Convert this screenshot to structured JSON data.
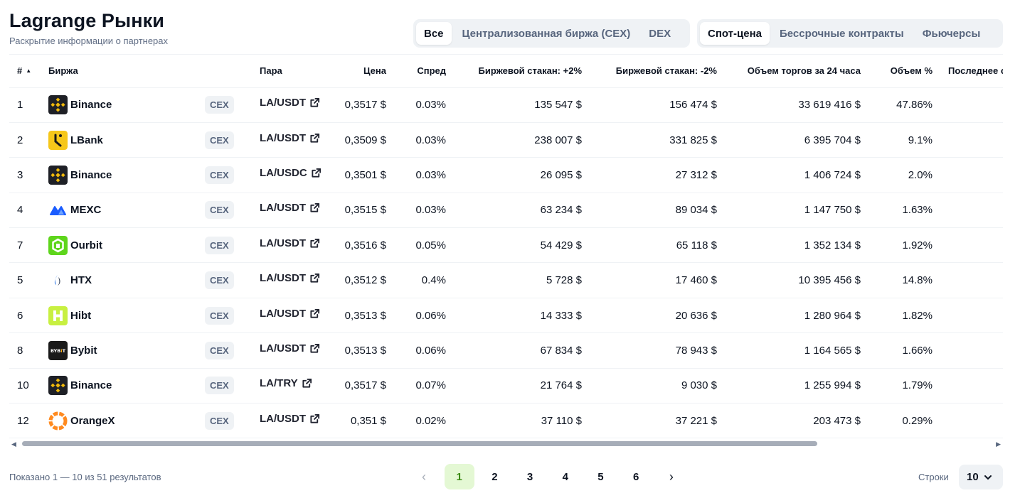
{
  "header": {
    "title": "Lagrange Рынки",
    "subtitle": "Раскрытие информации о партнерах"
  },
  "filters": {
    "market_type": [
      "Все",
      "Централизованная биржа (CEX)",
      "DEX"
    ],
    "market_type_active": "Все",
    "category": [
      "Спот-цена",
      "Бессрочные контракты",
      "Фьючерсы"
    ],
    "category_active": "Спот-цена"
  },
  "table": {
    "columns": [
      "#",
      "Биржа",
      "Пара",
      "Цена",
      "Спред",
      "Биржевой стакан: +2%",
      "Биржевой стакан: -2%",
      "Объем торгов за 24 часа",
      "Объем %",
      "Последнее о"
    ],
    "sort_indicator": "▲",
    "rows": [
      {
        "rank": "1",
        "exchange": "Binance",
        "icon": "binance-icon",
        "type": "CEX",
        "pair": "LA/USDT",
        "price": "0,3517 $",
        "spread": "0.03%",
        "depth_plus": "135 547 $",
        "depth_minus": "156 474 $",
        "volume": "33 619 416 $",
        "volume_pct": "47.86%"
      },
      {
        "rank": "2",
        "exchange": "LBank",
        "icon": "lbank-icon",
        "type": "CEX",
        "pair": "LA/USDT",
        "price": "0,3509 $",
        "spread": "0.03%",
        "depth_plus": "238 007 $",
        "depth_minus": "331 825 $",
        "volume": "6 395 704 $",
        "volume_pct": "9.1%"
      },
      {
        "rank": "3",
        "exchange": "Binance",
        "icon": "binance-icon",
        "type": "CEX",
        "pair": "LA/USDC",
        "price": "0,3501 $",
        "spread": "0.03%",
        "depth_plus": "26 095 $",
        "depth_minus": "27 312 $",
        "volume": "1 406 724 $",
        "volume_pct": "2.0%"
      },
      {
        "rank": "4",
        "exchange": "MEXC",
        "icon": "mexc-icon",
        "type": "CEX",
        "pair": "LA/USDT",
        "price": "0,3515 $",
        "spread": "0.03%",
        "depth_plus": "63 234 $",
        "depth_minus": "89 034 $",
        "volume": "1 147 750 $",
        "volume_pct": "1.63%"
      },
      {
        "rank": "7",
        "exchange": "Ourbit",
        "icon": "ourbit-icon",
        "type": "CEX",
        "pair": "LA/USDT",
        "price": "0,3516 $",
        "spread": "0.05%",
        "depth_plus": "54 429 $",
        "depth_minus": "65 118 $",
        "volume": "1 352 134 $",
        "volume_pct": "1.92%"
      },
      {
        "rank": "5",
        "exchange": "HTX",
        "icon": "htx-icon",
        "type": "CEX",
        "pair": "LA/USDT",
        "price": "0,3512 $",
        "spread": "0.4%",
        "depth_plus": "5 728 $",
        "depth_minus": "17 460 $",
        "volume": "10 395 456 $",
        "volume_pct": "14.8%"
      },
      {
        "rank": "6",
        "exchange": "Hibt",
        "icon": "hibt-icon",
        "type": "CEX",
        "pair": "LA/USDT",
        "price": "0,3513 $",
        "spread": "0.06%",
        "depth_plus": "14 333 $",
        "depth_minus": "20 636 $",
        "volume": "1 280 964 $",
        "volume_pct": "1.82%"
      },
      {
        "rank": "8",
        "exchange": "Bybit",
        "icon": "bybit-icon",
        "type": "CEX",
        "pair": "LA/USDT",
        "price": "0,3513 $",
        "spread": "0.06%",
        "depth_plus": "67 834 $",
        "depth_minus": "78 943 $",
        "volume": "1 164 565 $",
        "volume_pct": "1.66%"
      },
      {
        "rank": "10",
        "exchange": "Binance",
        "icon": "binance-icon",
        "type": "CEX",
        "pair": "LA/TRY",
        "price": "0,3517 $",
        "spread": "0.07%",
        "depth_plus": "21 764 $",
        "depth_minus": "9 030 $",
        "volume": "1 255 994 $",
        "volume_pct": "1.79%"
      },
      {
        "rank": "12",
        "exchange": "OrangeX",
        "icon": "orangex-icon",
        "type": "CEX",
        "pair": "LA/USDT",
        "price": "0,351 $",
        "spread": "0.02%",
        "depth_plus": "37 110 $",
        "depth_minus": "37 221 $",
        "volume": "203 473 $",
        "volume_pct": "0.29%"
      }
    ]
  },
  "footer": {
    "results_text": "Показано 1 — 10 из 51 результатов",
    "pages": [
      "1",
      "2",
      "3",
      "4",
      "5",
      "6"
    ],
    "current_page": "1",
    "prev_icon": "‹",
    "next_icon": "›",
    "rows_label": "Строки",
    "rows_value": "10"
  },
  "colors": {
    "accent_green": "#3b8b14",
    "accent_green_bg": "#e4f8d4",
    "binance": "#f0b90b",
    "lbank": "#f6c71a",
    "mexc": "#1a5cff",
    "ourbit": "#5ed51c",
    "htx": "#1d6de5",
    "hibt": "#c8f041",
    "bybit": "#1a1a1a",
    "orangex": "#ff8a1f"
  }
}
